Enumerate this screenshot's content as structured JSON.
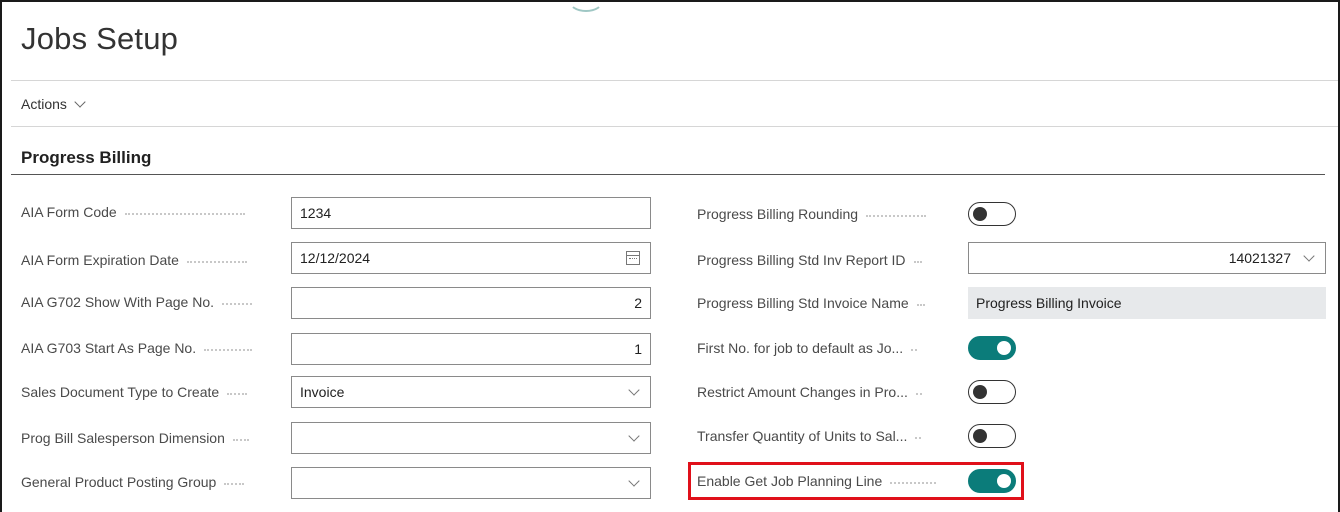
{
  "page": {
    "title": "Jobs Setup"
  },
  "actions": {
    "label": "Actions"
  },
  "section": {
    "title": "Progress Billing"
  },
  "left_fields": [
    {
      "label": "AIA Form Code",
      "value": "1234",
      "kind": "text"
    },
    {
      "label": "AIA Form Expiration Date",
      "value": "12/12/2024",
      "kind": "date"
    },
    {
      "label": "AIA G702 Show With Page No.",
      "value": "2",
      "kind": "number"
    },
    {
      "label": "AIA G703 Start As Page No.",
      "value": "1",
      "kind": "number"
    },
    {
      "label": "Sales Document Type to Create",
      "value": "Invoice",
      "kind": "dropdown"
    },
    {
      "label": "Prog Bill Salesperson Dimension",
      "value": "",
      "kind": "dropdown"
    },
    {
      "label": "General Product Posting Group",
      "value": "",
      "kind": "dropdown"
    }
  ],
  "right_fields": [
    {
      "label": "Progress Billing Rounding",
      "kind": "toggle",
      "checked": false
    },
    {
      "label": "Progress Billing Std Inv Report ID",
      "kind": "dropdown",
      "value": "14021327"
    },
    {
      "label": "Progress Billing Std Invoice Name",
      "kind": "readonly",
      "value": "Progress Billing Invoice"
    },
    {
      "label": "First No. for job to default as Jo...",
      "kind": "toggle",
      "checked": true
    },
    {
      "label": "Restrict Amount Changes in Pro...",
      "kind": "toggle",
      "checked": false
    },
    {
      "label": "Transfer Quantity of Units to Sal...",
      "kind": "toggle",
      "checked": false
    },
    {
      "label": "Enable Get Job Planning Line",
      "kind": "toggle",
      "checked": true,
      "highlighted": true
    }
  ],
  "colors": {
    "accent": "#0b7c7a",
    "highlight": "#e0101a"
  },
  "icons": {
    "date_picker": "calendar-icon",
    "dropdown": "chevron-down-icon",
    "actions": "chevron-down-icon"
  }
}
